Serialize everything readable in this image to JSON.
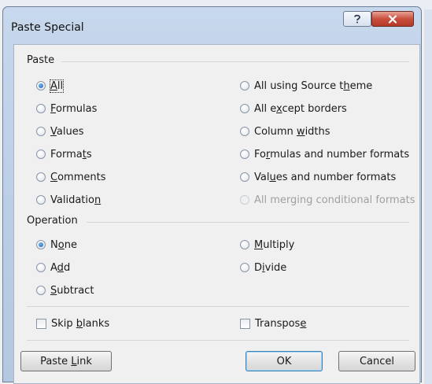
{
  "window": {
    "title": "Paste Special"
  },
  "colors": {
    "close_button": "#c94f3d",
    "radio_selected": "#1e5fae"
  },
  "paste": {
    "label": "Paste",
    "options": [
      {
        "pre": "",
        "key": "A",
        "post": "ll",
        "selected": true,
        "disabled": false
      },
      {
        "pre": "",
        "key": "F",
        "post": "ormulas",
        "selected": false,
        "disabled": false
      },
      {
        "pre": "",
        "key": "V",
        "post": "alues",
        "selected": false,
        "disabled": false
      },
      {
        "pre": "Forma",
        "key": "t",
        "post": "s",
        "selected": false,
        "disabled": false
      },
      {
        "pre": "",
        "key": "C",
        "post": "omments",
        "selected": false,
        "disabled": false
      },
      {
        "pre": "Validatio",
        "key": "n",
        "post": "",
        "selected": false,
        "disabled": false
      },
      {
        "pre": "All using Source t",
        "key": "h",
        "post": "eme",
        "selected": false,
        "disabled": false
      },
      {
        "pre": "All e",
        "key": "x",
        "post": "cept borders",
        "selected": false,
        "disabled": false
      },
      {
        "pre": "Column ",
        "key": "w",
        "post": "idths",
        "selected": false,
        "disabled": false
      },
      {
        "pre": "Fo",
        "key": "r",
        "post": "mulas and number formats",
        "selected": false,
        "disabled": false
      },
      {
        "pre": "Val",
        "key": "u",
        "post": "es and number formats",
        "selected": false,
        "disabled": false
      },
      {
        "pre": "All merging conditional formats",
        "key": "",
        "post": "",
        "selected": false,
        "disabled": true
      }
    ]
  },
  "operation": {
    "label": "Operation",
    "options": [
      {
        "pre": "N",
        "key": "o",
        "post": "ne",
        "selected": true
      },
      {
        "pre": "A",
        "key": "d",
        "post": "d",
        "selected": false
      },
      {
        "pre": "",
        "key": "S",
        "post": "ubtract",
        "selected": false
      },
      {
        "pre": "",
        "key": "M",
        "post": "ultiply",
        "selected": false
      },
      {
        "pre": "D",
        "key": "i",
        "post": "vide",
        "selected": false
      }
    ]
  },
  "checkboxes": {
    "skip_blanks": {
      "pre": "Skip ",
      "key": "b",
      "post": "lanks",
      "checked": false
    },
    "transpose": {
      "pre": "Transpos",
      "key": "e",
      "post": "",
      "checked": false
    }
  },
  "buttons": {
    "paste_link": {
      "pre": "Paste ",
      "key": "L",
      "post": "ink"
    },
    "ok": "OK",
    "cancel": "Cancel"
  }
}
